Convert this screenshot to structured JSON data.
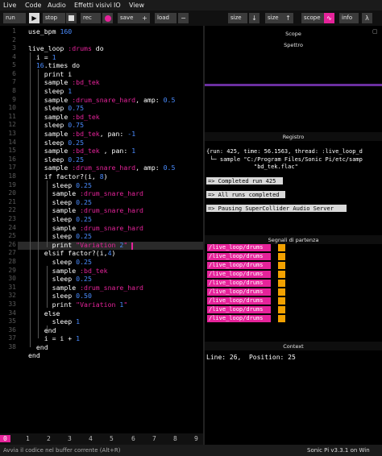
{
  "menu": [
    "Live",
    "Code",
    "Audio",
    "Effetti visivi",
    "IO",
    "View"
  ],
  "toolbar": {
    "run": "run",
    "stop": "stop",
    "rec": "rec",
    "save": "save",
    "load": "load",
    "size1": "size",
    "size2": "size",
    "scope": "scope",
    "info": "info",
    "colors": {
      "accent": "#e5239a",
      "button_bg": "#3b3b3b"
    }
  },
  "editor": {
    "line_numbers": [
      "1",
      "2",
      "3",
      "4",
      "5",
      "6",
      "7",
      "8",
      "9",
      "10",
      "11",
      "12",
      "13",
      "14",
      "15",
      "16",
      "17",
      "18",
      "19",
      "20",
      "21",
      "22",
      "23",
      "24",
      "25",
      "26",
      "27",
      "28",
      "29",
      "30",
      "31",
      "32",
      "33",
      "34",
      "35",
      "36",
      "37",
      "38"
    ],
    "lines": [
      "use_bpm 160",
      "",
      "live_loop :drums do",
      "  i = 1",
      "  16.times do",
      "    print i",
      "    sample :bd_tek",
      "    sleep 1",
      "    sample :drum_snare_hard, amp: 0.5",
      "    sleep 0.75",
      "    sample :bd_tek",
      "    sleep 0.75",
      "    sample :bd_tek, pan: -1",
      "    sleep 0.25",
      "    sample :bd_tek , pan: 1",
      "    sleep 0.25",
      "    sample :drum_snare_hard, amp: 0.5",
      "    if factor?(i, 8)",
      "      sleep 0.25",
      "      sample :drum_snare_hard",
      "      sleep 0.25",
      "      sample :drum_snare_hard",
      "      sleep 0.25",
      "      sample :drum_snare_hard",
      "      sleep 0.25",
      "      print \"Variation 2\"",
      "    elsif factor?(i,4)",
      "      sleep 0.25",
      "      sample :bd_tek",
      "      sleep 0.25",
      "      sample :drum_snare_hard",
      "      sleep 0.50",
      "      print \"Variation 1\"",
      "    else",
      "      sleep 1",
      "    end",
      "    i = i + 1",
      "  end",
      "end"
    ]
  },
  "panels": {
    "scope_title": "Scope",
    "spectrum_title": "Spettro",
    "log_title": "Registro",
    "log_lines": [
      "{run: 425, time: 56.1563, thread: :live_loop_d",
      " └─ sample \"C:/Program Files/Sonic Pi/etc/samp",
      "              \"bd_tek.flac\""
    ],
    "log_highlights": [
      "=> Completed run 425",
      "=> All runs completed",
      "=> Pausing SuperCollider Audio Server"
    ],
    "cues_title": "Segnali di partenza",
    "cues": [
      "/live_loop/drums",
      "/live_loop/drums",
      "/live_loop/drums",
      "/live_loop/drums",
      "/live_loop/drums",
      "/live_loop/drums",
      "/live_loop/drums",
      "/live_loop/drums",
      "/live_loop/drums"
    ],
    "context_title": "Context",
    "context_text": "Line: 26,  Position: 25"
  },
  "buffers": [
    "0",
    "1",
    "2",
    "3",
    "4",
    "5",
    "6",
    "7",
    "8",
    "9"
  ],
  "status": {
    "left": "Avvia il codice nel buffer corrente (Alt+R)",
    "right": "Sonic Pi v3.3.1 on Win"
  }
}
